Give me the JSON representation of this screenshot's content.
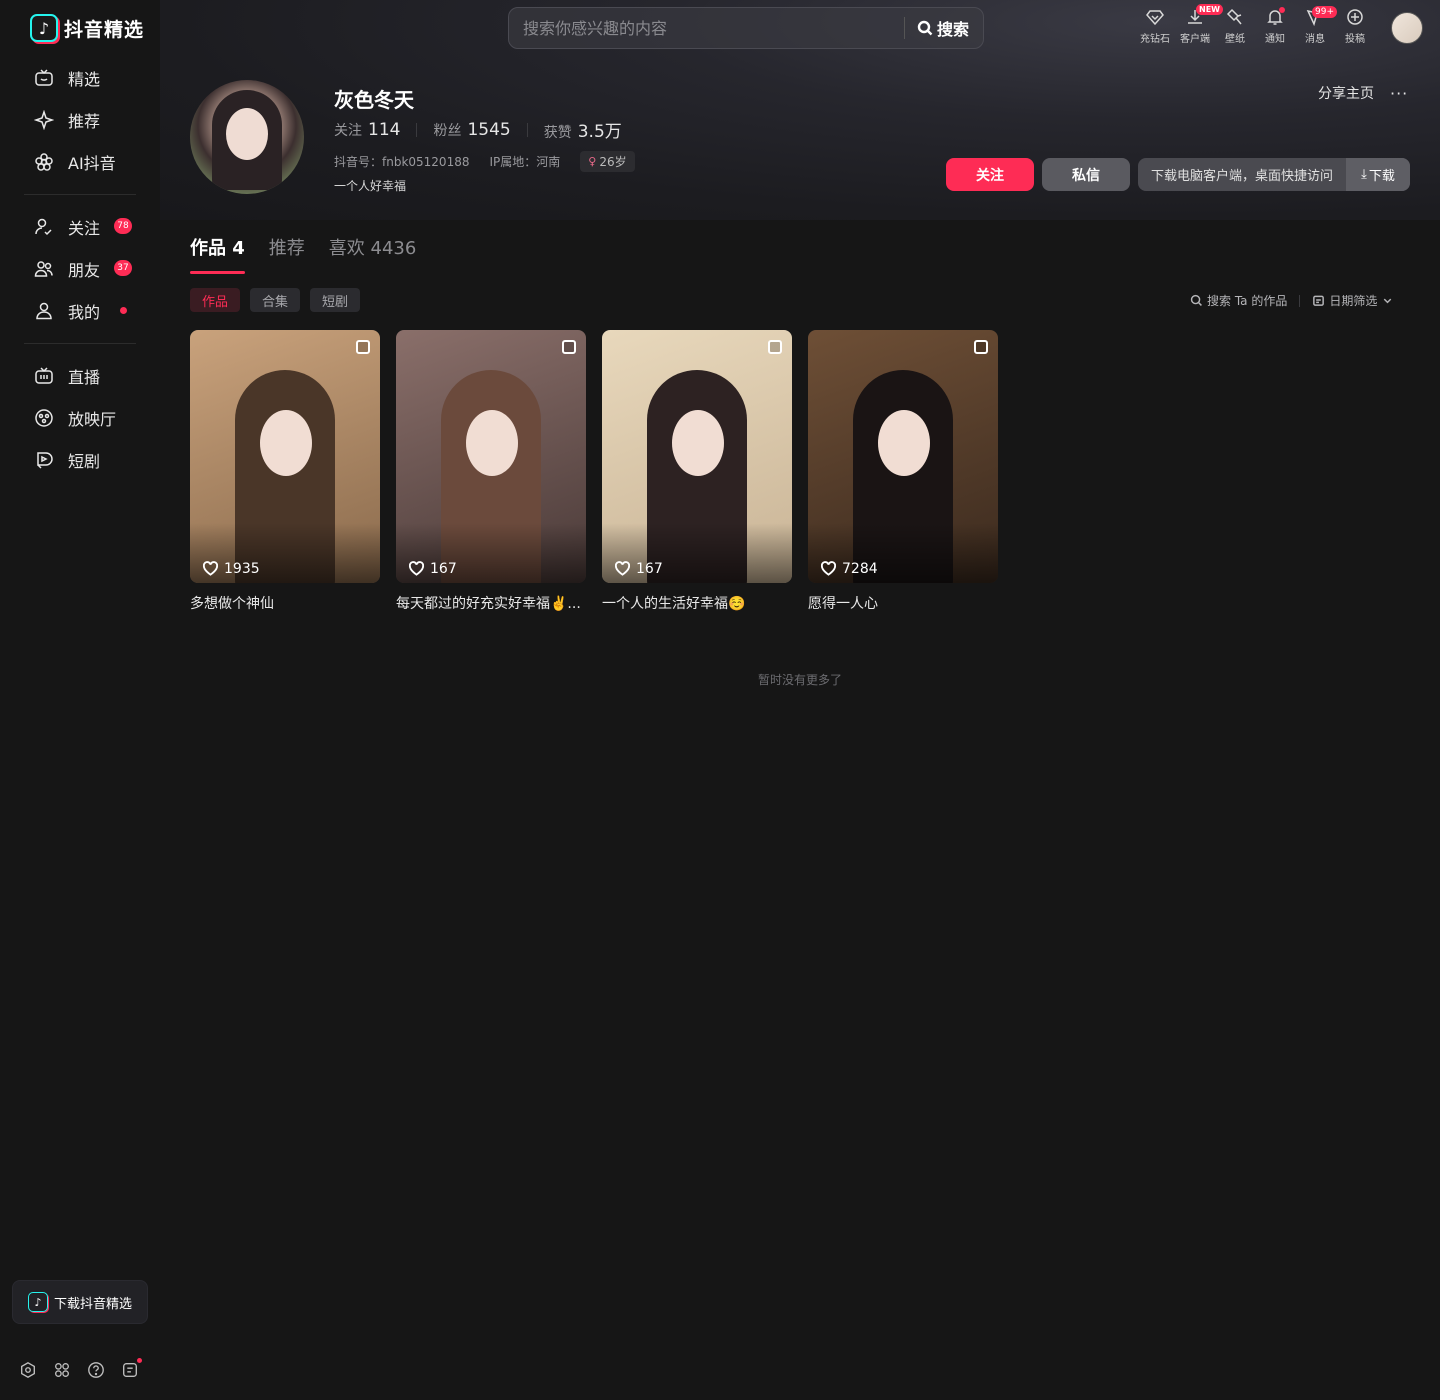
{
  "app": {
    "logo_text": "抖音精选"
  },
  "sidebar": {
    "group1": [
      {
        "label": "精选",
        "icon": "smile-tv-icon"
      },
      {
        "label": "推荐",
        "icon": "sparkle-icon"
      },
      {
        "label": "AI抖音",
        "icon": "ai-flower-icon"
      }
    ],
    "group2": [
      {
        "label": "关注",
        "icon": "follow-icon",
        "badge": "78"
      },
      {
        "label": "朋友",
        "icon": "friends-icon",
        "badge": "37"
      },
      {
        "label": "我的",
        "icon": "user-icon",
        "dot": true
      }
    ],
    "group3": [
      {
        "label": "直播",
        "icon": "live-tv-icon"
      },
      {
        "label": "放映厅",
        "icon": "theater-icon"
      },
      {
        "label": "短剧",
        "icon": "short-drama-icon"
      }
    ],
    "download_label": "下载抖音精选"
  },
  "header": {
    "search_placeholder": "搜索你感兴趣的内容",
    "search_button": "搜索",
    "actions": [
      {
        "label": "充钻石",
        "icon": "diamond-icon"
      },
      {
        "label": "客户端",
        "icon": "download-icon",
        "badge": "NEW"
      },
      {
        "label": "壁纸",
        "icon": "wallpaper-icon"
      },
      {
        "label": "通知",
        "icon": "bell-icon",
        "dot": true
      },
      {
        "label": "消息",
        "icon": "message-icon",
        "badge": "99+"
      },
      {
        "label": "投稿",
        "icon": "upload-plus-icon"
      }
    ]
  },
  "profile": {
    "name": "灰色冬天",
    "stats": [
      {
        "key": "关注",
        "value": "114"
      },
      {
        "key": "粉丝",
        "value": "1545"
      },
      {
        "key": "获赞",
        "value": "3.5万"
      }
    ],
    "douyin_id": "抖音号：fnbk05120188",
    "ip_location": "IP属地：河南",
    "age": "26岁",
    "bio": "一个人好幸福",
    "share_label": "分享主页",
    "more_label": "···",
    "follow_button": "关注",
    "message_button": "私信",
    "download_text": "下载电脑客户端，桌面快捷访问",
    "download_button": "下载"
  },
  "tabs": [
    {
      "label": "作品 4",
      "active": true
    },
    {
      "label": "推荐",
      "active": false
    },
    {
      "label": "喜欢 4436",
      "active": false
    }
  ],
  "subtabs": [
    {
      "label": "作品",
      "active": true
    },
    {
      "label": "合集",
      "active": false
    },
    {
      "label": "短剧",
      "active": false
    }
  ],
  "filters": {
    "search_label": "搜索 Ta 的作品",
    "date_label": "日期筛选"
  },
  "works": [
    {
      "likes": "1935",
      "title": "多想做个神仙",
      "colors": {
        "bg": "#8a6a4c",
        "bg2": "#c9a27c",
        "hair": "#4a3628"
      }
    },
    {
      "likes": "167",
      "title": "每天都过的好充实好幸福✌️...",
      "colors": {
        "bg": "#4a3a38",
        "bg2": "#8a6f6a",
        "hair": "#6b4a3c"
      }
    },
    {
      "likes": "167",
      "title": "一个人的生活好幸福☺️",
      "colors": {
        "bg": "#c9b496",
        "bg2": "#e8d8bc",
        "hair": "#2d2222"
      }
    },
    {
      "likes": "7284",
      "title": "愿得一人心",
      "colors": {
        "bg": "#3b2a1e",
        "bg2": "#6e4f36",
        "hair": "#1a1414"
      }
    }
  ],
  "no_more": "暂时没有更多了"
}
